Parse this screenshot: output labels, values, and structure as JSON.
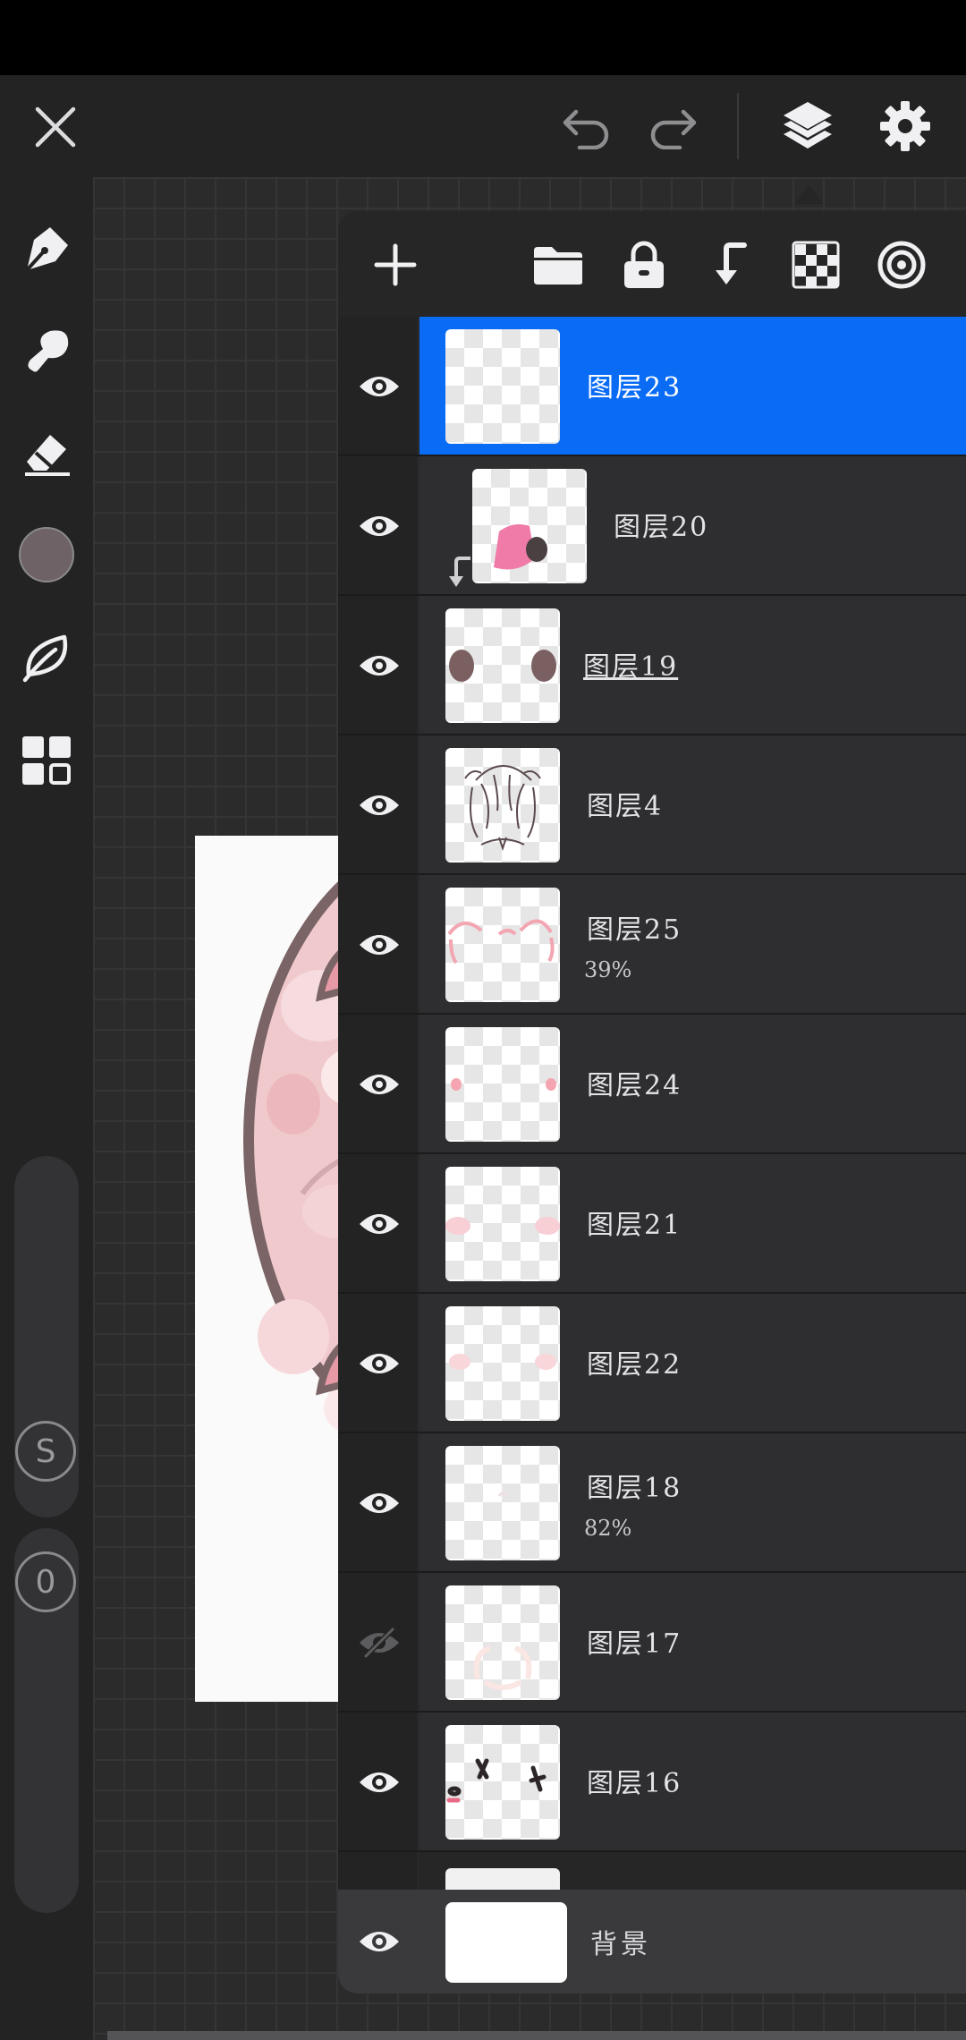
{
  "toolbar": {
    "icons": [
      "close-icon",
      "undo-icon",
      "redo-icon",
      "layers-icon",
      "settings-gear-icon"
    ]
  },
  "left_tools": {
    "icons": [
      "pen-icon",
      "smudge-icon",
      "eraser-icon",
      "color-swatch",
      "leaf-icon",
      "grid-icon"
    ],
    "color": "#6e6266",
    "size_badge": "S",
    "opacity_badge": "0"
  },
  "layers_panel": {
    "header_icons": [
      "add-layer-icon",
      "folder-icon",
      "lock-icon",
      "clip-mask-icon",
      "transparency-icon",
      "blend-target-icon"
    ],
    "accent": "#0a6cf5",
    "layers": [
      {
        "name": "图层23",
        "opacity": "",
        "visible": true,
        "selected": true,
        "clipped": false
      },
      {
        "name": "图层20",
        "opacity": "",
        "visible": true,
        "selected": false,
        "clipped": true
      },
      {
        "name": "图层19",
        "opacity": "",
        "visible": true,
        "selected": false,
        "clipped": false
      },
      {
        "name": "图层4",
        "opacity": "",
        "visible": true,
        "selected": false,
        "clipped": false
      },
      {
        "name": "图层25",
        "opacity": "39%",
        "visible": true,
        "selected": false,
        "clipped": false
      },
      {
        "name": "图层24",
        "opacity": "",
        "visible": true,
        "selected": false,
        "clipped": false
      },
      {
        "name": "图层21",
        "opacity": "",
        "visible": true,
        "selected": false,
        "clipped": false
      },
      {
        "name": "图层22",
        "opacity": "",
        "visible": true,
        "selected": false,
        "clipped": false
      },
      {
        "name": "图层18",
        "opacity": "82%",
        "visible": true,
        "selected": false,
        "clipped": false
      },
      {
        "name": "图层17",
        "opacity": "",
        "visible": false,
        "selected": false,
        "clipped": false
      },
      {
        "name": "图层16",
        "opacity": "",
        "visible": true,
        "selected": false,
        "clipped": false
      }
    ],
    "background_layer": {
      "name": "背景",
      "visible": true
    }
  }
}
